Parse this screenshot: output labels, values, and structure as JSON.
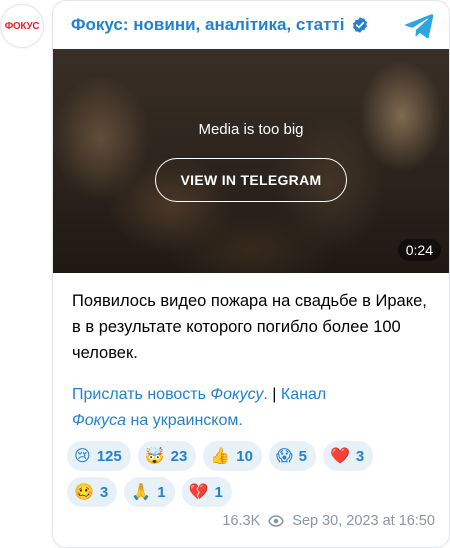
{
  "avatar": {
    "text": "ФОКУС"
  },
  "header": {
    "channel_title": "Фокус: новини, аналітика, статті"
  },
  "media": {
    "message": "Media is too big",
    "button_label": "VIEW IN TELEGRAM",
    "duration": "0:24"
  },
  "post": {
    "text": "Появилось видео пожара на свадьбе в Ираке, в в результате которого погибло более 100 человек.",
    "link1_prefix": "Прислать новость ",
    "link1_italic": "Фокусу",
    "link1_suffix": ".",
    "separator": "|",
    "link2_prefix": "Канал",
    "link2_italic": "Фокуса",
    "link2_suffix": " на украинском."
  },
  "reactions": [
    {
      "emoji": "😢",
      "count": "125"
    },
    {
      "emoji": "🤯",
      "count": "23"
    },
    {
      "emoji": "👍",
      "count": "10"
    },
    {
      "emoji": "😱",
      "count": "5"
    },
    {
      "emoji": "❤️",
      "count": "3"
    },
    {
      "emoji": "🥴",
      "count": "3"
    },
    {
      "emoji": "🙏",
      "count": "1"
    },
    {
      "emoji": "💔",
      "count": "1"
    }
  ],
  "footer": {
    "views": "16.3K",
    "date": "Sep 30, 2023 at 16:50"
  },
  "colors": {
    "accent": "#2481cc",
    "reaction_bg": "#e8f0f8",
    "muted": "#8a96a3",
    "brand_red": "#e8262d"
  }
}
